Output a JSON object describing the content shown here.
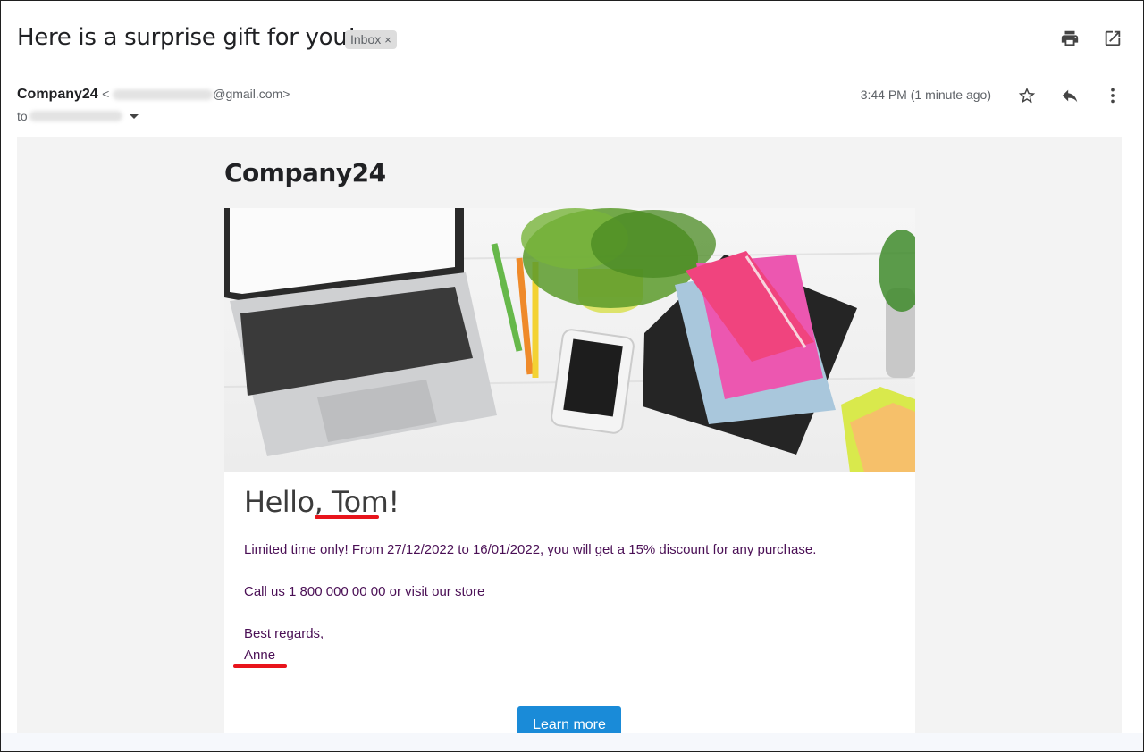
{
  "subject": "Here is a surprise gift for you!",
  "label": {
    "text": "Inbox",
    "remove": "×"
  },
  "header_icons": [
    "print-icon",
    "open-in-new-window-icon"
  ],
  "sender": {
    "name": "Company24",
    "email_prefix": "<",
    "email_suffix": "@gmail.com>"
  },
  "recipient": {
    "to_label": "to"
  },
  "time": "3:44 PM (1 minute ago)",
  "action_icons": [
    "star-icon",
    "reply-icon",
    "more-vertical-icon"
  ],
  "email": {
    "brand": "Company24",
    "hero_alt": "Laptop, phone, plant, notebooks and sticky notes on a white desk",
    "greeting": "Hello, Tom!",
    "line1": "Limited time only! From 27/12/2022 to 16/01/2022, you will get a 15% discount for any purchase.",
    "line2": "Call us 1 800 000 00 00 or visit our store",
    "closing": "Best regards,",
    "signature": "Anne",
    "cta": "Learn more"
  },
  "colors": {
    "accent_red": "#e8141b",
    "body_text": "#4a0f55",
    "button": "#1a8bd8"
  }
}
